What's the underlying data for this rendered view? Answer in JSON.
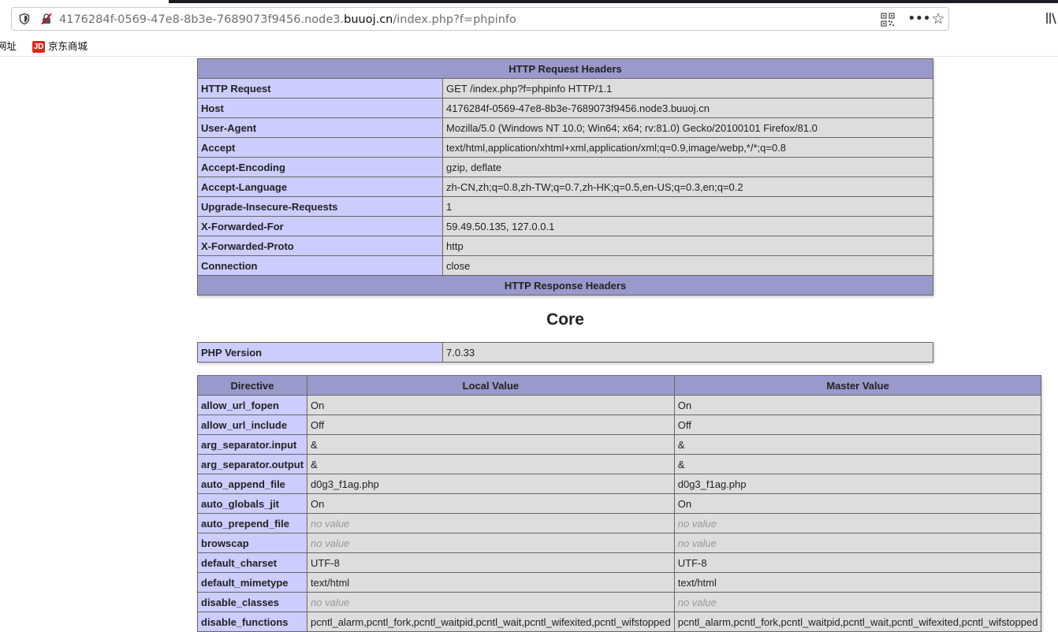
{
  "browser": {
    "url_prefix": "4176284f-0569-47e8-8b3e-7689073f9456.node3.",
    "url_domain": "buuoj.cn",
    "url_path": "/index.php?f=phpinfo",
    "bookmarks": [
      {
        "label": "网址"
      },
      {
        "label": "京东商城",
        "icon_text": "JD"
      }
    ]
  },
  "request_headers": {
    "title": "HTTP Request Headers",
    "rows": [
      {
        "key": "HTTP Request",
        "value": "GET /index.php?f=phpinfo HTTP/1.1"
      },
      {
        "key": "Host",
        "value": "4176284f-0569-47e8-8b3e-7689073f9456.node3.buuoj.cn"
      },
      {
        "key": "User-Agent",
        "value": "Mozilla/5.0 (Windows NT 10.0; Win64; x64; rv:81.0) Gecko/20100101 Firefox/81.0"
      },
      {
        "key": "Accept",
        "value": "text/html,application/xhtml+xml,application/xml;q=0.9,image/webp,*/*;q=0.8"
      },
      {
        "key": "Accept-Encoding",
        "value": "gzip, deflate"
      },
      {
        "key": "Accept-Language",
        "value": "zh-CN,zh;q=0.8,zh-TW;q=0.7,zh-HK;q=0.5,en-US;q=0.3,en;q=0.2"
      },
      {
        "key": "Upgrade-Insecure-Requests",
        "value": "1"
      },
      {
        "key": "X-Forwarded-For",
        "value": "59.49.50.135, 127.0.0.1"
      },
      {
        "key": "X-Forwarded-Proto",
        "value": "http"
      },
      {
        "key": "Connection",
        "value": "close"
      }
    ],
    "response_title": "HTTP Response Headers"
  },
  "core": {
    "title": "Core",
    "php_version_label": "PHP Version",
    "php_version": "7.0.33",
    "columns": [
      "Directive",
      "Local Value",
      "Master Value"
    ],
    "directives": [
      {
        "name": "allow_url_fopen",
        "local": "On",
        "master": "On"
      },
      {
        "name": "allow_url_include",
        "local": "Off",
        "master": "Off"
      },
      {
        "name": "arg_separator.input",
        "local": "&",
        "master": "&"
      },
      {
        "name": "arg_separator.output",
        "local": "&",
        "master": "&"
      },
      {
        "name": "auto_append_file",
        "local": "d0g3_f1ag.php",
        "master": "d0g3_f1ag.php"
      },
      {
        "name": "auto_globals_jit",
        "local": "On",
        "master": "On"
      },
      {
        "name": "auto_prepend_file",
        "local": "no value",
        "master": "no value"
      },
      {
        "name": "browscap",
        "local": "no value",
        "master": "no value"
      },
      {
        "name": "default_charset",
        "local": "UTF-8",
        "master": "UTF-8"
      },
      {
        "name": "default_mimetype",
        "local": "text/html",
        "master": "text/html"
      },
      {
        "name": "disable_classes",
        "local": "no value",
        "master": "no value"
      },
      {
        "name": "disable_functions",
        "local": "pcntl_alarm,pcntl_fork,pcntl_waitpid,pcntl_wait,pcntl_wifexited,pcntl_wifstopped",
        "master": "pcntl_alarm,pcntl_fork,pcntl_waitpid,pcntl_wait,pcntl_wifexited,pcntl_wifstopped"
      }
    ]
  }
}
